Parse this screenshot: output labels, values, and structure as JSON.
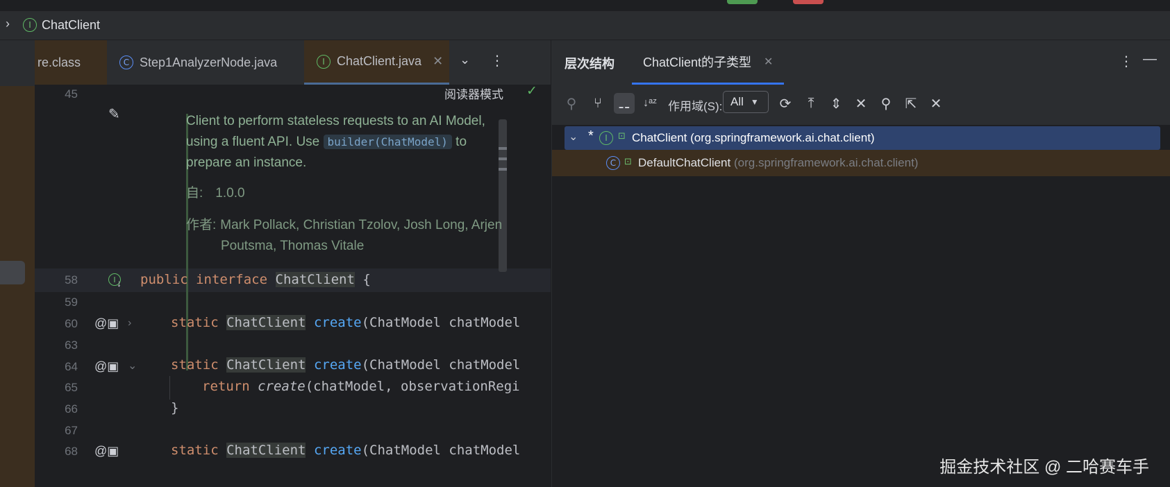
{
  "breadcrumb": {
    "item": "ChatClient"
  },
  "editor_tabs": [
    {
      "label": "re.class"
    },
    {
      "label": "Step1AnalyzerNode.java"
    },
    {
      "label": "ChatClient.java"
    }
  ],
  "reader_mode_label": "阅读器模式",
  "doc": {
    "line1": "Client to perform stateless requests to an AI Model,",
    "line2_a": "using a fluent API. Use ",
    "line2_code": "builder(ChatModel)",
    "line2_b": " to",
    "line3": "prepare an instance.",
    "since_label": "自:",
    "since_value": "1.0.0",
    "author_label": "作者:",
    "author_line1": "Mark Pollack, Christian Tzolov, Josh Long, Arjen",
    "author_line2": "Poutsma, Thomas Vitale"
  },
  "line_numbers": [
    "45",
    "58",
    "59",
    "60",
    "63",
    "64",
    "65",
    "66",
    "67",
    "68"
  ],
  "code": {
    "l58_kw1": "public",
    "l58_kw2": "interface",
    "l58_name": "ChatClient",
    "l58_brace": " {",
    "static_kw": "static",
    "type": "ChatClient",
    "create_fn": "create",
    "l60_rest": "(ChatModel chatModel",
    "l64_rest": "(ChatModel chatModel",
    "l65_kw": "return",
    "l65_fn": "create",
    "l65_rest": "(chatModel, observationRegi",
    "l66": "}",
    "l68_rest": "(ChatModel chatModel"
  },
  "hierarchy": {
    "title": "层次结构",
    "tab": "ChatClient的子类型",
    "scope_label": "作用域(S):",
    "scope_value": "All",
    "root": {
      "name": "ChatClient",
      "pkg": "(org.springframework.ai.chat.client)"
    },
    "child": {
      "name": "DefaultChatClient",
      "pkg": "(org.springframework.ai.chat.client)"
    }
  },
  "watermark": "掘金技术社区 @ 二哈赛车手",
  "colors": {
    "accent": "#3574f0",
    "selection": "#2e436e",
    "brown": "#3b2e1f"
  }
}
